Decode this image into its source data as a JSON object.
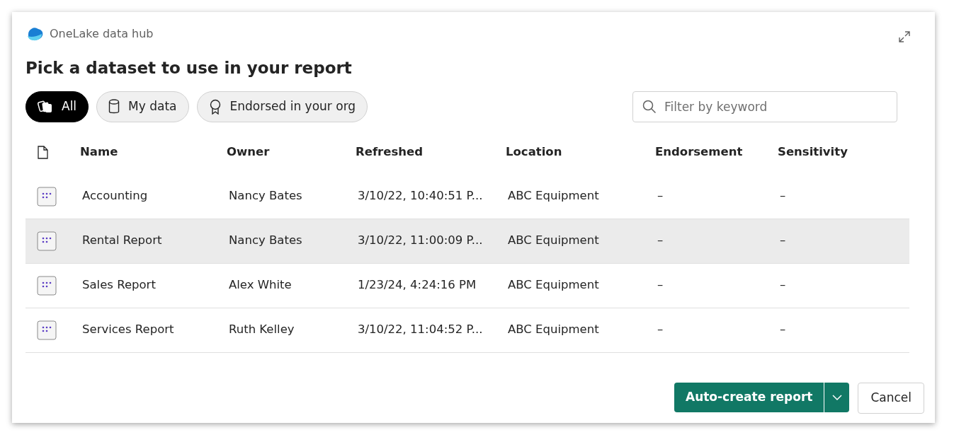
{
  "window": {
    "title": "OneLake data hub"
  },
  "heading": "Pick a dataset to use in your report",
  "filters": [
    {
      "label": "All",
      "kind": "all",
      "selected": true
    },
    {
      "label": "My data",
      "kind": "data",
      "selected": false
    },
    {
      "label": "Endorsed in your org",
      "kind": "endorsed",
      "selected": false
    }
  ],
  "search": {
    "placeholder": "Filter by keyword"
  },
  "table": {
    "columns": [
      "Name",
      "Owner",
      "Refreshed",
      "Location",
      "Endorsement",
      "Sensitivity"
    ],
    "rows": [
      {
        "cells": [
          "Accounting",
          "Nancy Bates",
          "3/10/22, 10:40:51 P...",
          "ABC Equipment",
          "–",
          "–"
        ],
        "selected": false
      },
      {
        "cells": [
          "Rental Report",
          "Nancy Bates",
          "3/10/22, 11:00:09 P...",
          "ABC Equipment",
          "–",
          "–"
        ],
        "selected": true
      },
      {
        "cells": [
          "Sales Report",
          "Alex White",
          "1/23/24, 4:24:16 PM",
          "ABC Equipment",
          "–",
          "–"
        ],
        "selected": false
      },
      {
        "cells": [
          "Services Report",
          "Ruth Kelley",
          "3/10/22, 11:04:52 P...",
          "ABC Equipment",
          "–",
          "–"
        ],
        "selected": false
      }
    ]
  },
  "buttons": {
    "primary": "Auto-create report",
    "secondary": "Cancel"
  }
}
